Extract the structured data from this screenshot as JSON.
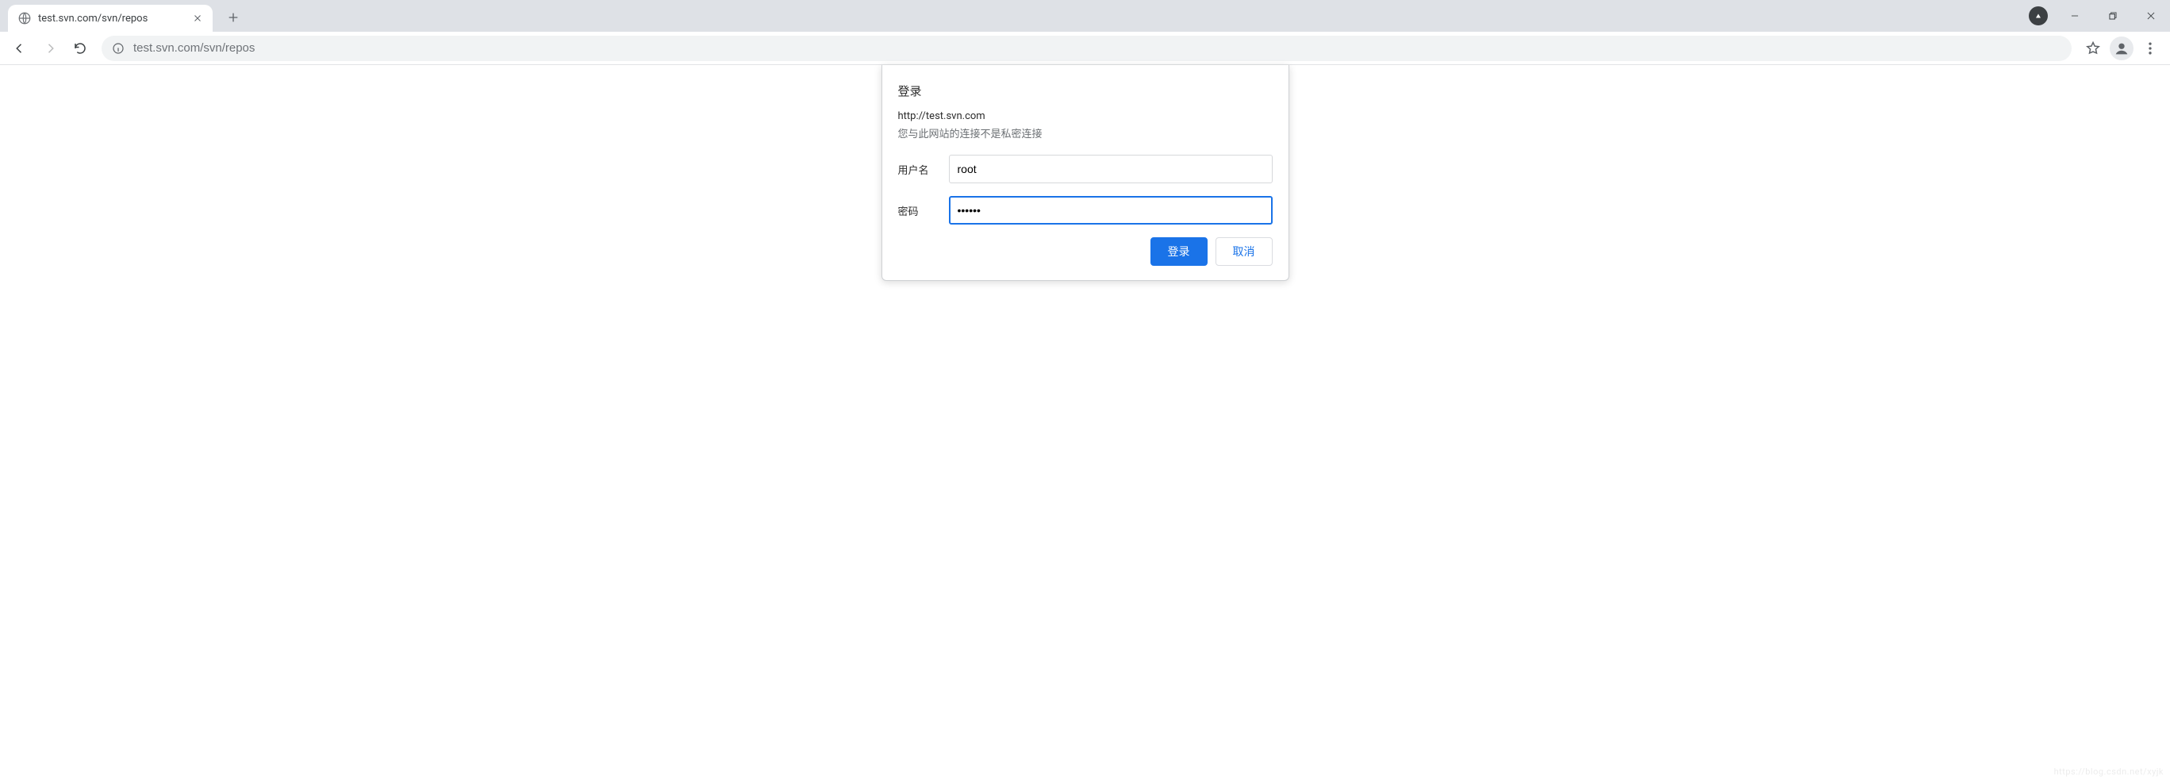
{
  "window": {
    "incognito_tooltip": "incognito"
  },
  "tab": {
    "title": "test.svn.com/svn/repos"
  },
  "toolbar": {
    "url": "test.svn.com/svn/repos"
  },
  "dialog": {
    "title": "登录",
    "origin": "http://test.svn.com",
    "warning": "您与此网站的连接不是私密连接",
    "username_label": "用户名",
    "username_value": "root",
    "password_label": "密码",
    "password_value": "••••••",
    "login_button": "登录",
    "cancel_button": "取消"
  },
  "watermark": "https://blog.csdn.net/xyjk"
}
